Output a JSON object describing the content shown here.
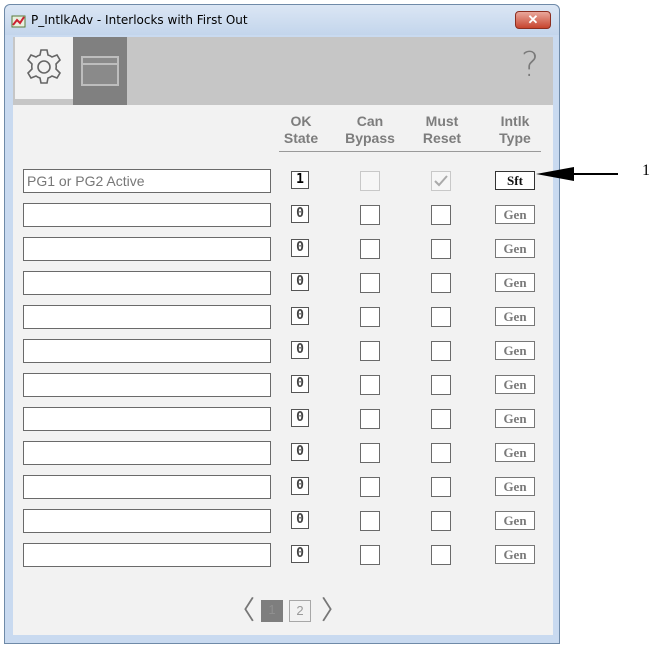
{
  "window": {
    "title": "P_IntlkAdv - Interlocks with First Out",
    "close_label": "✕"
  },
  "toolbar": {
    "help_label": "?"
  },
  "headers": {
    "ok": [
      "OK",
      "State"
    ],
    "bypass": [
      "Can",
      "Bypass"
    ],
    "reset": [
      "Must",
      "Reset"
    ],
    "type": [
      "Intlk",
      "Type"
    ]
  },
  "rows": [
    {
      "name": "PG1 or PG2 Active",
      "ok": "1",
      "can_bypass": false,
      "must_reset": true,
      "disabled": true,
      "type": "Sft"
    },
    {
      "name": "",
      "ok": "0",
      "can_bypass": false,
      "must_reset": false,
      "disabled": false,
      "type": "Gen"
    },
    {
      "name": "",
      "ok": "0",
      "can_bypass": false,
      "must_reset": false,
      "disabled": false,
      "type": "Gen"
    },
    {
      "name": "",
      "ok": "0",
      "can_bypass": false,
      "must_reset": false,
      "disabled": false,
      "type": "Gen"
    },
    {
      "name": "",
      "ok": "0",
      "can_bypass": false,
      "must_reset": false,
      "disabled": false,
      "type": "Gen"
    },
    {
      "name": "",
      "ok": "0",
      "can_bypass": false,
      "must_reset": false,
      "disabled": false,
      "type": "Gen"
    },
    {
      "name": "",
      "ok": "0",
      "can_bypass": false,
      "must_reset": false,
      "disabled": false,
      "type": "Gen"
    },
    {
      "name": "",
      "ok": "0",
      "can_bypass": false,
      "must_reset": false,
      "disabled": false,
      "type": "Gen"
    },
    {
      "name": "",
      "ok": "0",
      "can_bypass": false,
      "must_reset": false,
      "disabled": false,
      "type": "Gen"
    },
    {
      "name": "",
      "ok": "0",
      "can_bypass": false,
      "must_reset": false,
      "disabled": false,
      "type": "Gen"
    },
    {
      "name": "",
      "ok": "0",
      "can_bypass": false,
      "must_reset": false,
      "disabled": false,
      "type": "Gen"
    },
    {
      "name": "",
      "ok": "0",
      "can_bypass": false,
      "must_reset": false,
      "disabled": false,
      "type": "Gen"
    }
  ],
  "pager": {
    "pages": [
      "1",
      "2"
    ],
    "current": "1",
    "prev": "〈",
    "next": "〉"
  },
  "callout": {
    "label": "1"
  }
}
